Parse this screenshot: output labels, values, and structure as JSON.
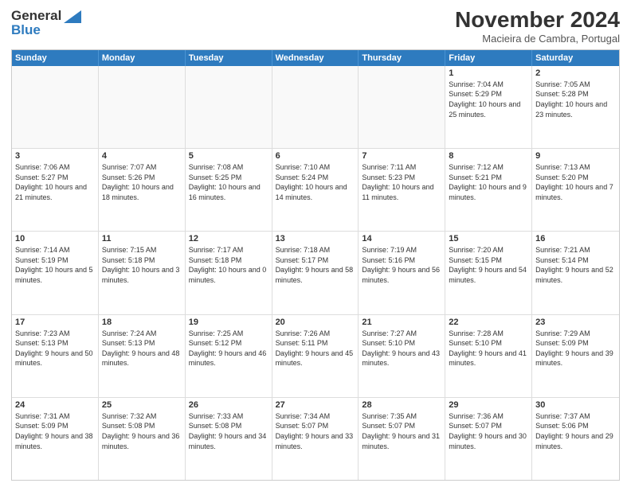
{
  "header": {
    "logo_general": "General",
    "logo_blue": "Blue",
    "month_title": "November 2024",
    "location": "Macieira de Cambra, Portugal"
  },
  "days_of_week": [
    "Sunday",
    "Monday",
    "Tuesday",
    "Wednesday",
    "Thursday",
    "Friday",
    "Saturday"
  ],
  "weeks": [
    [
      {
        "day": "",
        "info": ""
      },
      {
        "day": "",
        "info": ""
      },
      {
        "day": "",
        "info": ""
      },
      {
        "day": "",
        "info": ""
      },
      {
        "day": "",
        "info": ""
      },
      {
        "day": "1",
        "info": "Sunrise: 7:04 AM\nSunset: 5:29 PM\nDaylight: 10 hours and 25 minutes."
      },
      {
        "day": "2",
        "info": "Sunrise: 7:05 AM\nSunset: 5:28 PM\nDaylight: 10 hours and 23 minutes."
      }
    ],
    [
      {
        "day": "3",
        "info": "Sunrise: 7:06 AM\nSunset: 5:27 PM\nDaylight: 10 hours and 21 minutes."
      },
      {
        "day": "4",
        "info": "Sunrise: 7:07 AM\nSunset: 5:26 PM\nDaylight: 10 hours and 18 minutes."
      },
      {
        "day": "5",
        "info": "Sunrise: 7:08 AM\nSunset: 5:25 PM\nDaylight: 10 hours and 16 minutes."
      },
      {
        "day": "6",
        "info": "Sunrise: 7:10 AM\nSunset: 5:24 PM\nDaylight: 10 hours and 14 minutes."
      },
      {
        "day": "7",
        "info": "Sunrise: 7:11 AM\nSunset: 5:23 PM\nDaylight: 10 hours and 11 minutes."
      },
      {
        "day": "8",
        "info": "Sunrise: 7:12 AM\nSunset: 5:21 PM\nDaylight: 10 hours and 9 minutes."
      },
      {
        "day": "9",
        "info": "Sunrise: 7:13 AM\nSunset: 5:20 PM\nDaylight: 10 hours and 7 minutes."
      }
    ],
    [
      {
        "day": "10",
        "info": "Sunrise: 7:14 AM\nSunset: 5:19 PM\nDaylight: 10 hours and 5 minutes."
      },
      {
        "day": "11",
        "info": "Sunrise: 7:15 AM\nSunset: 5:18 PM\nDaylight: 10 hours and 3 minutes."
      },
      {
        "day": "12",
        "info": "Sunrise: 7:17 AM\nSunset: 5:18 PM\nDaylight: 10 hours and 0 minutes."
      },
      {
        "day": "13",
        "info": "Sunrise: 7:18 AM\nSunset: 5:17 PM\nDaylight: 9 hours and 58 minutes."
      },
      {
        "day": "14",
        "info": "Sunrise: 7:19 AM\nSunset: 5:16 PM\nDaylight: 9 hours and 56 minutes."
      },
      {
        "day": "15",
        "info": "Sunrise: 7:20 AM\nSunset: 5:15 PM\nDaylight: 9 hours and 54 minutes."
      },
      {
        "day": "16",
        "info": "Sunrise: 7:21 AM\nSunset: 5:14 PM\nDaylight: 9 hours and 52 minutes."
      }
    ],
    [
      {
        "day": "17",
        "info": "Sunrise: 7:23 AM\nSunset: 5:13 PM\nDaylight: 9 hours and 50 minutes."
      },
      {
        "day": "18",
        "info": "Sunrise: 7:24 AM\nSunset: 5:13 PM\nDaylight: 9 hours and 48 minutes."
      },
      {
        "day": "19",
        "info": "Sunrise: 7:25 AM\nSunset: 5:12 PM\nDaylight: 9 hours and 46 minutes."
      },
      {
        "day": "20",
        "info": "Sunrise: 7:26 AM\nSunset: 5:11 PM\nDaylight: 9 hours and 45 minutes."
      },
      {
        "day": "21",
        "info": "Sunrise: 7:27 AM\nSunset: 5:10 PM\nDaylight: 9 hours and 43 minutes."
      },
      {
        "day": "22",
        "info": "Sunrise: 7:28 AM\nSunset: 5:10 PM\nDaylight: 9 hours and 41 minutes."
      },
      {
        "day": "23",
        "info": "Sunrise: 7:29 AM\nSunset: 5:09 PM\nDaylight: 9 hours and 39 minutes."
      }
    ],
    [
      {
        "day": "24",
        "info": "Sunrise: 7:31 AM\nSunset: 5:09 PM\nDaylight: 9 hours and 38 minutes."
      },
      {
        "day": "25",
        "info": "Sunrise: 7:32 AM\nSunset: 5:08 PM\nDaylight: 9 hours and 36 minutes."
      },
      {
        "day": "26",
        "info": "Sunrise: 7:33 AM\nSunset: 5:08 PM\nDaylight: 9 hours and 34 minutes."
      },
      {
        "day": "27",
        "info": "Sunrise: 7:34 AM\nSunset: 5:07 PM\nDaylight: 9 hours and 33 minutes."
      },
      {
        "day": "28",
        "info": "Sunrise: 7:35 AM\nSunset: 5:07 PM\nDaylight: 9 hours and 31 minutes."
      },
      {
        "day": "29",
        "info": "Sunrise: 7:36 AM\nSunset: 5:07 PM\nDaylight: 9 hours and 30 minutes."
      },
      {
        "day": "30",
        "info": "Sunrise: 7:37 AM\nSunset: 5:06 PM\nDaylight: 9 hours and 29 minutes."
      }
    ]
  ]
}
